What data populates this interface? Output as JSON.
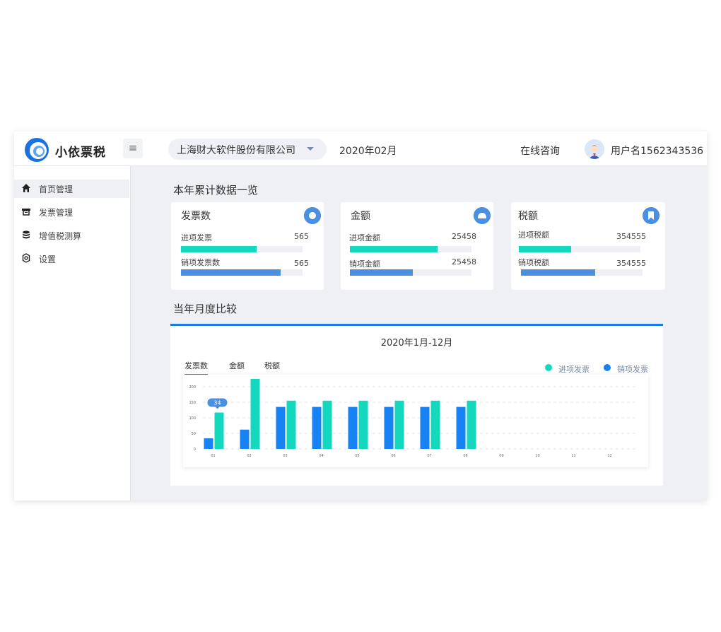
{
  "app": {
    "brand": "小依票税"
  },
  "header": {
    "menu_glyph": "≡",
    "company": "上海财大软件股份有限公司",
    "period": "2020年02月",
    "consult": "在线咨询",
    "username": "用户名1562343536"
  },
  "sidebar": {
    "items": [
      {
        "label": "首页管理",
        "icon": "home-icon",
        "active": true
      },
      {
        "label": "发票管理",
        "icon": "printer-icon",
        "active": false
      },
      {
        "label": "增值税测算",
        "icon": "coins-icon",
        "active": false
      },
      {
        "label": "设置",
        "icon": "gear-icon",
        "active": false
      }
    ]
  },
  "overview": {
    "title": "本年累计数据一览",
    "cards": [
      {
        "title": "发票数",
        "icon": "circle-icon",
        "rows": [
          {
            "label": "进项发票",
            "value": "565",
            "level": 0.62
          },
          {
            "label": "销项发票数",
            "value": "565",
            "level": 0.82
          }
        ]
      },
      {
        "title": "金额",
        "icon": "dome-icon",
        "rows": [
          {
            "label": "进项金额",
            "value": "25458",
            "level": 0.72
          },
          {
            "label": "销项金额",
            "value": "25458",
            "level": 0.52
          }
        ]
      },
      {
        "title": "税额",
        "icon": "bookmark-icon",
        "rows": [
          {
            "label": "进项税额",
            "value": "354555",
            "level": 0.43
          },
          {
            "label": "销项税额",
            "value": "354555",
            "level": 0.61
          }
        ]
      }
    ]
  },
  "monthly": {
    "title": "当年月度比较",
    "chart_title": "2020年1月-12月",
    "tabs": [
      "发票数",
      "金额",
      "税额"
    ],
    "active_tab": 0,
    "legend": [
      "进项发票",
      "销项发票"
    ]
  },
  "colors": {
    "teal": "#13d8bd",
    "blue": "#1682f4",
    "accent": "#1a7de1",
    "bar_blue": "#4a8fe2"
  },
  "chart_data": {
    "type": "bar",
    "title": "2020年1月-12月",
    "categories": [
      "01",
      "02",
      "03",
      "04",
      "05",
      "06",
      "07",
      "08",
      "09",
      "10",
      "11",
      "12"
    ],
    "series": [
      {
        "name": "销项发票",
        "values": [
          34,
          62,
          135,
          135,
          135,
          135,
          135,
          135,
          0,
          0,
          0,
          0
        ]
      },
      {
        "name": "进项发票",
        "values": [
          117,
          225,
          155,
          155,
          155,
          155,
          155,
          155,
          0,
          0,
          0,
          0
        ]
      }
    ],
    "yticks": [
      "0",
      "50",
      "100",
      "150",
      "200"
    ],
    "ylim": [
      0,
      200
    ],
    "tooltip": {
      "category": "01",
      "value": "34"
    },
    "grid": true,
    "legend_position": "top-right"
  }
}
